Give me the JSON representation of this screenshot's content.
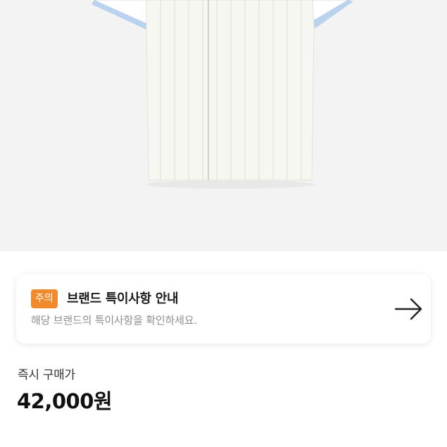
{
  "product": {
    "image_alt": "product-photo-shirt"
  },
  "notice": {
    "badge": "주의",
    "title": "브랜드 특이사항 안내",
    "description": "해당 브랜드의 특이사항을 확인하세요.",
    "icon": "arrow-right-icon"
  },
  "purchase": {
    "label": "즉시 구매가",
    "price": "42,000원"
  },
  "colors": {
    "accent_badge": "#ef8a2d",
    "image_bg": "#f3f3f3",
    "sleeve_trim": "#b9d2ee"
  }
}
